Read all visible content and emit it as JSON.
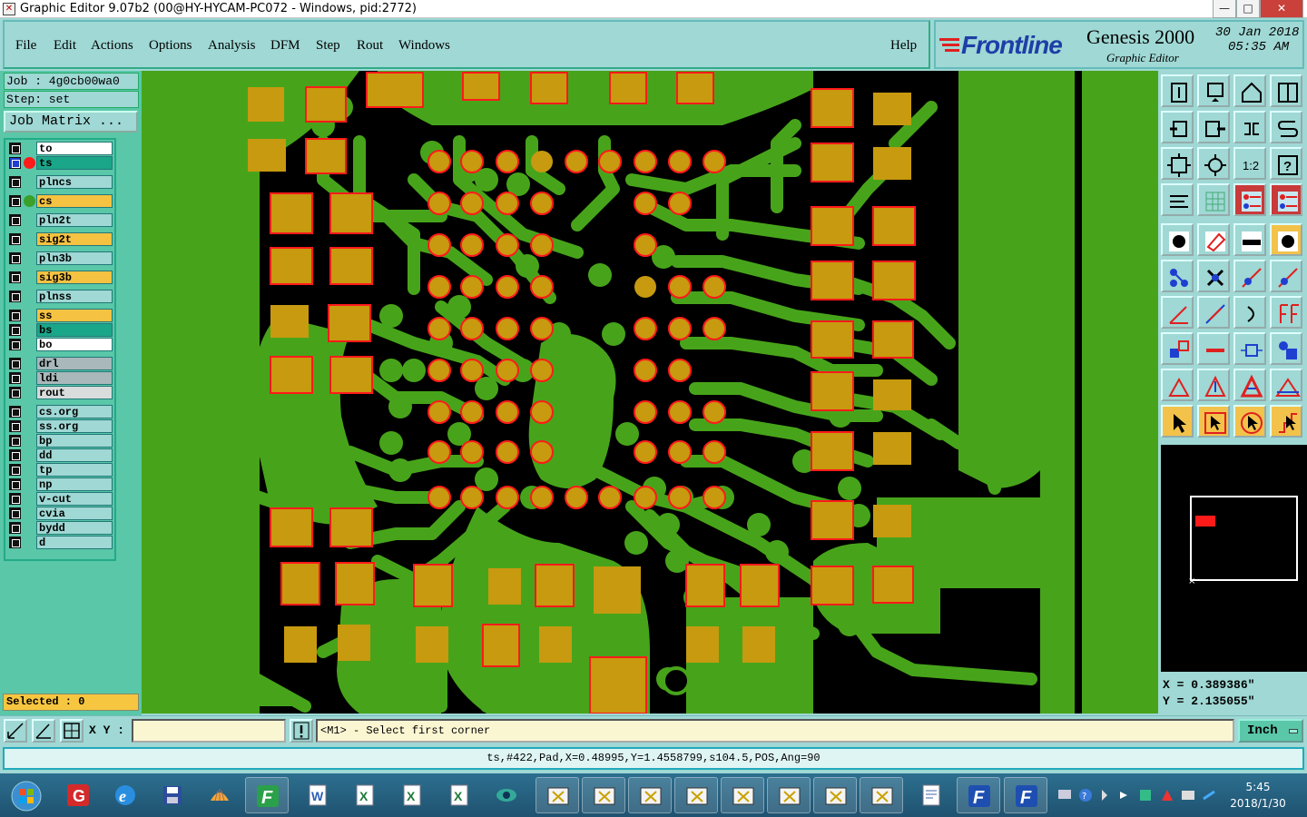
{
  "window": {
    "title": "Graphic Editor 9.07b2 (00@HY-HYCAM-PC072 - Windows, pid:2772)",
    "controls": {
      "minimize": "—",
      "maximize": "□",
      "close": "✕"
    }
  },
  "menu": {
    "items": [
      "File",
      "Edit",
      "Actions",
      "Options",
      "Analysis",
      "DFM",
      "Step",
      "Rout",
      "Windows"
    ],
    "help": "Help"
  },
  "brand": {
    "logo": "Frontline",
    "product": "Genesis 2000",
    "subtitle": "Graphic Editor",
    "date": "30 Jan 2018",
    "time": "05:35 AM"
  },
  "job": {
    "job_label": "Job : 4g0cb00wa0",
    "step_label": "Step: set",
    "matrix_button": "Job Matrix ..."
  },
  "layers": [
    {
      "name": "to",
      "color": "#ffffff"
    },
    {
      "name": "ts",
      "color": "#1aa688",
      "work": true
    },
    {
      "name": "plncs",
      "color": "#9fd8d4"
    },
    {
      "name": "cs",
      "color": "#f5c242",
      "affected": true
    },
    {
      "name": "pln2t",
      "color": "#9fd8d4"
    },
    {
      "name": "sig2t",
      "color": "#f5c242"
    },
    {
      "name": "pln3b",
      "color": "#9fd8d4"
    },
    {
      "name": "sig3b",
      "color": "#f5c242"
    },
    {
      "name": "plnss",
      "color": "#9fd8d4"
    },
    {
      "name": "ss",
      "color": "#f5c242"
    },
    {
      "name": "bs",
      "color": "#1aa688"
    },
    {
      "name": "bo",
      "color": "#ffffff"
    },
    {
      "name": "drl",
      "color": "#a8b8bb"
    },
    {
      "name": "ldi",
      "color": "#a8b8bb"
    },
    {
      "name": "rout",
      "color": "#d8dcdc"
    },
    {
      "name": "cs.org",
      "color": "#9fd8d4"
    },
    {
      "name": "ss.org",
      "color": "#9fd8d4"
    },
    {
      "name": "bp",
      "color": "#9fd8d4"
    },
    {
      "name": "dd",
      "color": "#9fd8d4"
    },
    {
      "name": "tp",
      "color": "#9fd8d4"
    },
    {
      "name": "np",
      "color": "#9fd8d4"
    },
    {
      "name": "v-cut",
      "color": "#9fd8d4"
    },
    {
      "name": "cvia",
      "color": "#9fd8d4"
    },
    {
      "name": "bydd",
      "color": "#9fd8d4"
    },
    {
      "name": "d",
      "color": "#9fd8d4"
    }
  ],
  "selected": "Selected : 0",
  "coords": {
    "x": "X = 0.389386\"",
    "y": "Y = 2.135055\""
  },
  "command": {
    "xy_label": "X Y :",
    "xy_value": "",
    "prompt": "<M1> - Select first corner",
    "units": "Inch"
  },
  "status": "ts,#422,Pad,X=0.48995,Y=1.4558799,s104.5,POS,Ang=90",
  "taskbar": {
    "time": "5:45",
    "date": "2018/1/30"
  },
  "colors": {
    "copper": "#47a41a",
    "pad": "#c79a10",
    "pad_outline": "#ff1a1a",
    "background": "#000000"
  }
}
